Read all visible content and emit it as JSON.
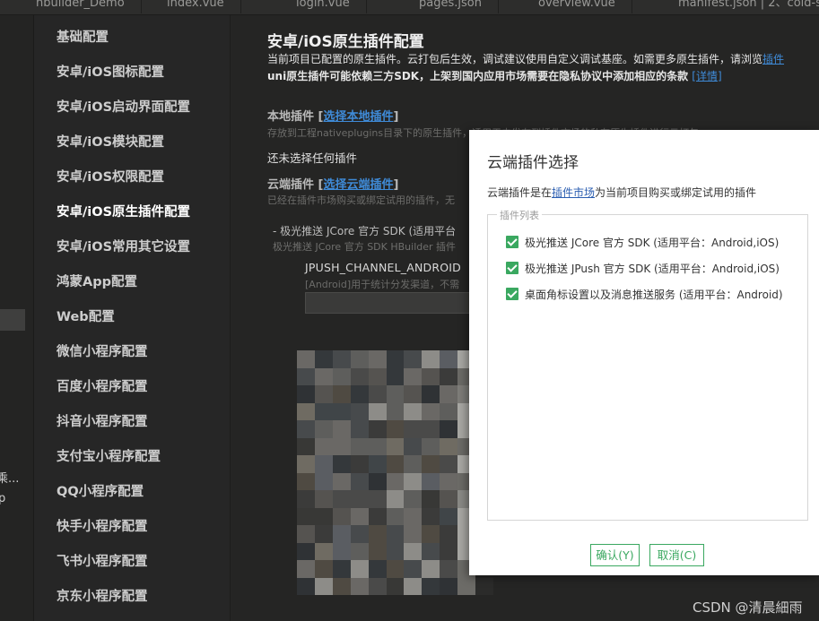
{
  "tabs": [
    "hbuilder_Demo",
    "index.vue",
    "login.vue",
    "pages.json",
    "overview.vue",
    "manifest.json | 2、cold-sto..."
  ],
  "left_strip": {
    "text1": "乘...",
    "text2": "p"
  },
  "nav": {
    "items": [
      "基础配置",
      "安卓/iOS图标配置",
      "安卓/iOS启动界面配置",
      "安卓/iOS模块配置",
      "安卓/iOS权限配置",
      "安卓/iOS原生插件配置",
      "安卓/iOS常用其它设置",
      "鸿蒙App配置",
      "Web配置",
      "微信小程序配置",
      "百度小程序配置",
      "抖音小程序配置",
      "支付宝小程序配置",
      "QQ小程序配置",
      "快手小程序配置",
      "飞书小程序配置",
      "京东小程序配置"
    ],
    "active_index": 5
  },
  "main": {
    "title": "安卓/iOS原生插件配置",
    "desc1_text": "当前项目已配置的原生插件。云打包后生效，调试建议使用自定义调试基座。如需更多原生插件，请浏览",
    "desc1_link": "插件",
    "desc2_text": "uni原生插件可能依赖三方SDK，上架到国内应用市场需要在隐私协议中添加相应的条款",
    "desc2_link": "[详情]",
    "local": {
      "title": "本地插件",
      "bracket_open": "[",
      "link": "选择本地插件",
      "bracket_close": "]",
      "hint": "存放到工程nativeplugins目录下的原生插件，适用于未发布到插件市场的私有原生插件进行云打包",
      "empty": "还未选择任何插件"
    },
    "cloud": {
      "title": "云端插件",
      "bracket_open": "[",
      "link": "选择云端插件",
      "bracket_close": "]",
      "hint": "已经在插件市场购买或绑定试用的插件，无"
    },
    "plugin": {
      "line": "- 极光推送 JCore 官方 SDK (适用平台",
      "sub": "极光推送 JCore 官方 SDK HBuilder 插件",
      "param_name": "JPUSH_CHANNEL_ANDROID",
      "param_hint": "[Android]用于统计分发渠道，不需"
    }
  },
  "dialog": {
    "title": "云端插件选择",
    "desc_prefix": "云端插件是在",
    "desc_link": "插件市场",
    "desc_suffix": "为当前项目购买或绑定试用的插件",
    "legend": "插件列表",
    "options": [
      {
        "label": "极光推送 JCore 官方 SDK (适用平台：Android,iOS)",
        "checked": true
      },
      {
        "label": "极光推送 JPush 官方 SDK (适用平台：Android,iOS)",
        "checked": true
      },
      {
        "label": "桌面角标设置以及消息推送服务 (适用平台：Android)",
        "checked": true
      }
    ],
    "confirm": "确认(Y)",
    "cancel": "取消(C)",
    "accent": "#3aa860"
  },
  "watermark": "CSDN @清晨細雨"
}
